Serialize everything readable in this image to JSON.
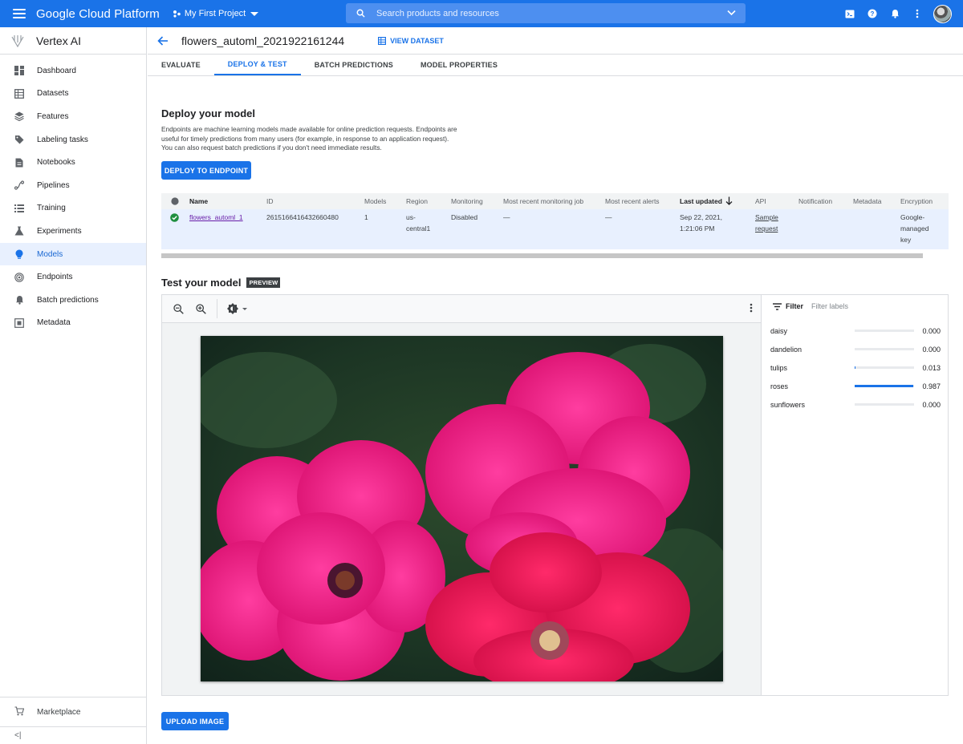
{
  "topbar": {
    "brand": "Google Cloud Platform",
    "project": "My First Project",
    "search_placeholder": "Search products and resources"
  },
  "sidebar": {
    "title": "Vertex AI",
    "items": [
      {
        "label": "Dashboard",
        "icon": "dashboard-icon"
      },
      {
        "label": "Datasets",
        "icon": "datasets-icon"
      },
      {
        "label": "Features",
        "icon": "features-icon"
      },
      {
        "label": "Labeling tasks",
        "icon": "label-icon"
      },
      {
        "label": "Notebooks",
        "icon": "notebook-icon"
      },
      {
        "label": "Pipelines",
        "icon": "pipelines-icon"
      },
      {
        "label": "Training",
        "icon": "training-icon"
      },
      {
        "label": "Experiments",
        "icon": "experiments-icon"
      },
      {
        "label": "Models",
        "icon": "models-icon",
        "active": true
      },
      {
        "label": "Endpoints",
        "icon": "endpoints-icon"
      },
      {
        "label": "Batch predictions",
        "icon": "bell-icon"
      },
      {
        "label": "Metadata",
        "icon": "metadata-icon"
      }
    ],
    "marketplace": "Marketplace",
    "collapse": "<|"
  },
  "header": {
    "title": "flowers_automl_2021922161244",
    "view_dataset": "VIEW DATASET"
  },
  "tabs": [
    "EVALUATE",
    "DEPLOY & TEST",
    "BATCH PREDICTIONS",
    "MODEL PROPERTIES"
  ],
  "active_tab": "DEPLOY & TEST",
  "deploy": {
    "title": "Deploy your model",
    "description": "Endpoints are machine learning models made available for online prediction requests. Endpoints are useful for timely predictions from many users (for example, in response to an application request). You can also request batch predictions if you don't need immediate results.",
    "button": "DEPLOY TO ENDPOINT"
  },
  "endpoints_table": {
    "columns": [
      "Name",
      "ID",
      "Models",
      "Region",
      "Monitoring",
      "Most recent monitoring job",
      "Most recent alerts",
      "Last updated",
      "API",
      "Notification",
      "Metadata",
      "Encryption"
    ],
    "sort_column": "Last updated",
    "rows": [
      {
        "status": "ok",
        "name": "flowers_automl_1",
        "id": "2615166416432660480",
        "models": "1",
        "region_1": "us-",
        "region_2": "central1",
        "monitoring": "Disabled",
        "monitoring_job": "—",
        "alerts": "—",
        "updated_1": "Sep 22, 2021,",
        "updated_2": "1:21:06 PM",
        "api_1": "Sample",
        "api_2": "request",
        "notification": "",
        "metadata": "",
        "encryption_1": "Google-",
        "encryption_2": "managed",
        "encryption_3": "key"
      }
    ]
  },
  "test": {
    "title": "Test your model",
    "badge": "PREVIEW",
    "filter_label": "Filter",
    "filter_placeholder": "Filter labels",
    "upload_button": "UPLOAD IMAGE",
    "predictions": [
      {
        "label": "daisy",
        "score": "0.000",
        "value": 0.0
      },
      {
        "label": "dandelion",
        "score": "0.000",
        "value": 0.0
      },
      {
        "label": "tulips",
        "score": "0.013",
        "value": 0.013
      },
      {
        "label": "roses",
        "score": "0.987",
        "value": 0.987
      },
      {
        "label": "sunflowers",
        "score": "0.000",
        "value": 0.0
      }
    ]
  },
  "colors": {
    "accent": "#1a73e8",
    "row_highlight": "#e8f0fe",
    "success": "#1e8e3e"
  }
}
